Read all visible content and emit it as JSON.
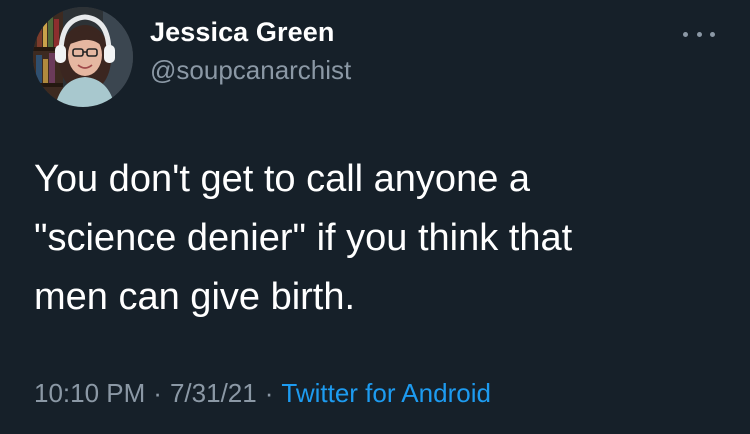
{
  "author": {
    "display_name": "Jessica Green",
    "handle": "@soupcanarchist"
  },
  "tweet": {
    "lines": [
      "You don't get to call anyone a",
      "\"science denier\" if you think that",
      "men can give birth."
    ]
  },
  "meta": {
    "time": "10:10 PM",
    "separator": "·",
    "date": "7/31/21",
    "source": "Twitter for Android"
  },
  "icons": {
    "more": "more-options-icon",
    "avatar": "profile-photo"
  },
  "colors": {
    "background": "#162029",
    "primary_text": "#ffffff",
    "secondary_text": "#8b98a5",
    "link": "#1d9bf0"
  }
}
